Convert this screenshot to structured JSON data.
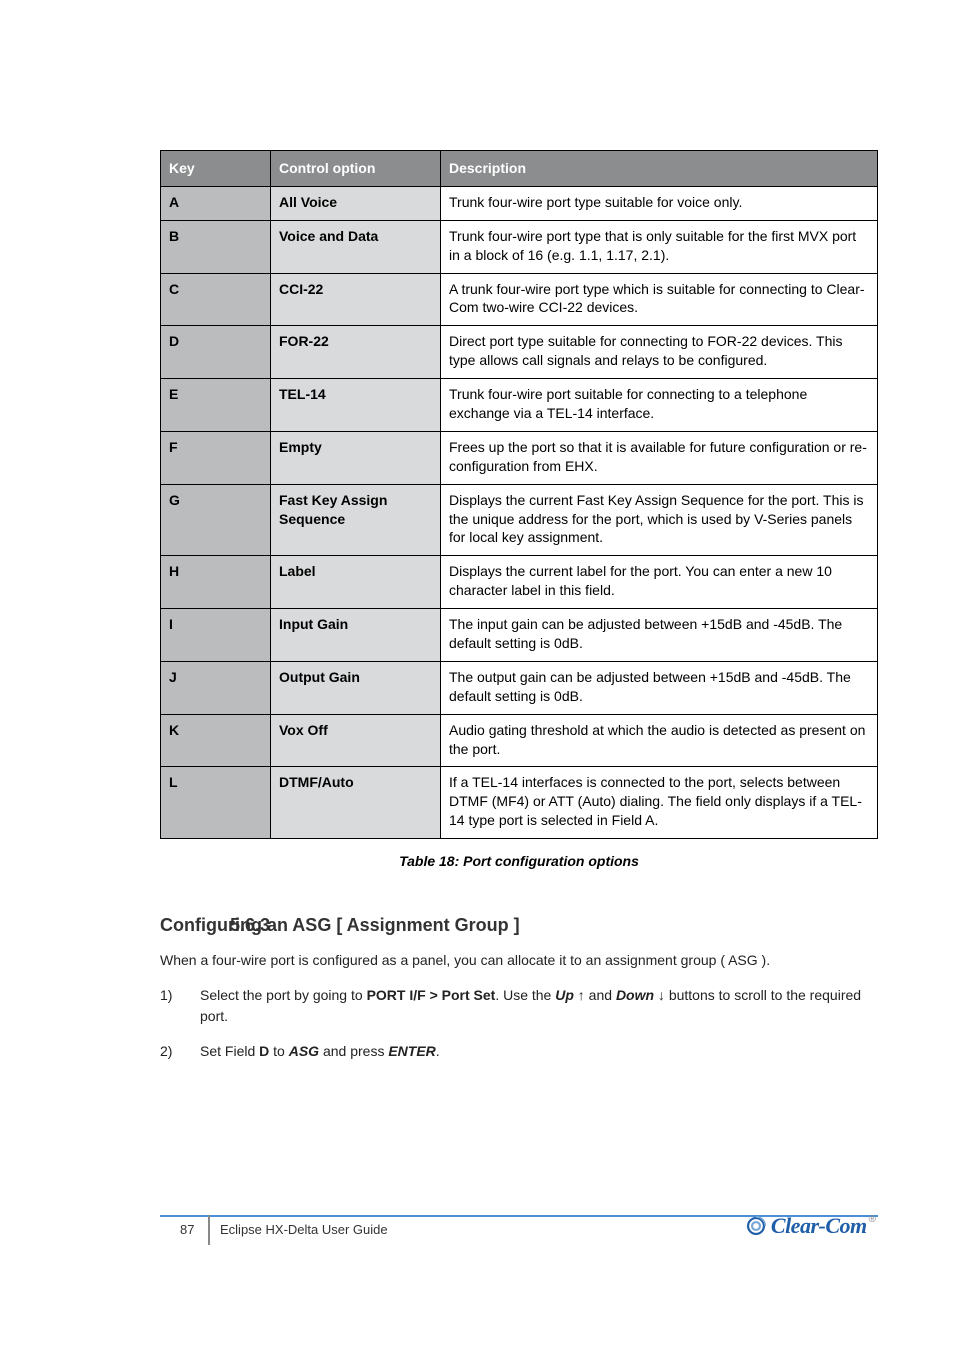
{
  "table": {
    "head": {
      "key": "Key",
      "control": "Control option",
      "description": "Description"
    },
    "rows": [
      {
        "key": "A",
        "control": "All Voice",
        "description": "Trunk four-wire port type suitable for voice only."
      },
      {
        "key": "B",
        "control": "Voice and Data",
        "description": "Trunk four-wire port type that is only suitable for the first MVX port in a block of 16 (e.g. 1.1, 1.17, 2.1)."
      },
      {
        "key": "C",
        "control": "CCI-22",
        "description": "A trunk four-wire port type which is suitable for connecting to Clear-Com two-wire CCI-22 devices."
      },
      {
        "key": "D",
        "control": "FOR-22",
        "description": "Direct port type suitable for connecting to FOR-22 devices. This type allows call signals and relays to be configured."
      },
      {
        "key": "E",
        "control": "TEL-14",
        "description": "Trunk four-wire port suitable for connecting to a telephone exchange via a TEL-14 interface."
      },
      {
        "key": "F",
        "control": "Empty",
        "description": "Frees up the port so that it is available for future configuration or re-configuration from EHX."
      },
      {
        "key": "G",
        "control": "Fast Key Assign Sequence",
        "description": "Displays the current Fast Key Assign Sequence for the port. This is the unique address for the port, which is used by V-Series panels for local key assignment."
      },
      {
        "key": "H",
        "control": "Label",
        "description": "Displays the current label for the port. You can enter a new 10 character label in this field."
      },
      {
        "key": "I",
        "control": "Input Gain",
        "description": "The input gain can be adjusted between +15dB and -45dB. The default setting is 0dB."
      },
      {
        "key": "J",
        "control": "Output Gain",
        "description": "The output gain can be adjusted between +15dB and -45dB. The default setting is 0dB."
      },
      {
        "key": "K",
        "control": "Vox Off",
        "description": "Audio gating threshold at which the audio is detected as present on the port."
      },
      {
        "key": "L",
        "control": "DTMF/Auto",
        "description": "If a TEL-14 interfaces is connected to the port, selects between DTMF (MF4) or ATT (Auto) dialing. The field only displays if a TEL-14 type port is selected in Field A."
      }
    ],
    "caption": "Table 18: Port configuration options"
  },
  "section": {
    "number": "5.6.3",
    "title": "Configuring an ASG [ Assignment Group ]"
  },
  "paragraph": "When a four-wire port is configured as a panel, you can allocate it to an assignment group ( ASG ).",
  "steps": [
    {
      "pre": "Select the port by going to ",
      "bold1": "PORT I/F > Port Set",
      "mid": ". Use the ",
      "bold2": "Up ↑",
      "and": " and ",
      "bold3": "Down ↓",
      "post": " buttons to scroll to the required port."
    },
    {
      "pre": "Set Field ",
      "bold1": "D",
      "mid": " to ",
      "bold2": "ASG",
      "mid2": " and press ",
      "bold3": "ENTER",
      "post": "."
    }
  ],
  "footer": {
    "page": "87",
    "doc": "Eclipse HX-Delta User Guide",
    "logo": "Clear-Com",
    "reg": "®"
  }
}
